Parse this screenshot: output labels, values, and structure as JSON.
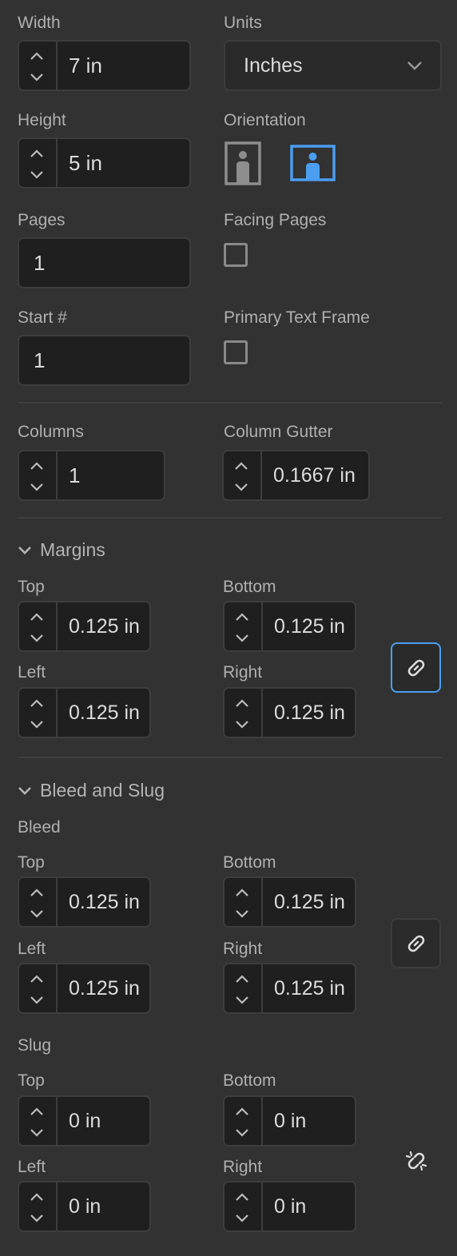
{
  "document": {
    "width_label": "Width",
    "width_value": "7 in",
    "units_label": "Units",
    "units_value": "Inches",
    "height_label": "Height",
    "height_value": "5 in",
    "orientation_label": "Orientation",
    "pages_label": "Pages",
    "pages_value": "1",
    "facing_label": "Facing Pages",
    "start_label": "Start #",
    "start_value": "1",
    "primary_label": "Primary Text Frame"
  },
  "columns": {
    "columns_label": "Columns",
    "columns_value": "1",
    "gutter_label": "Column Gutter",
    "gutter_value": "0.1667 in"
  },
  "margins": {
    "title": "Margins",
    "top_label": "Top",
    "top_value": "0.125 in",
    "bottom_label": "Bottom",
    "bottom_value": "0.125 in",
    "left_label": "Left",
    "left_value": "0.125 in",
    "right_label": "Right",
    "right_value": "0.125 in"
  },
  "bleed_slug": {
    "title": "Bleed and Slug",
    "bleed_label": "Bleed",
    "bleed_top_label": "Top",
    "bleed_top_value": "0.125 in",
    "bleed_bottom_label": "Bottom",
    "bleed_bottom_value": "0.125 in",
    "bleed_left_label": "Left",
    "bleed_left_value": "0.125 in",
    "bleed_right_label": "Right",
    "bleed_right_value": "0.125 in",
    "slug_label": "Slug",
    "slug_top_label": "Top",
    "slug_top_value": "0 in",
    "slug_bottom_label": "Bottom",
    "slug_bottom_value": "0 in",
    "slug_left_label": "Left",
    "slug_left_value": "0 in",
    "slug_right_label": "Right",
    "slug_right_value": "0 in"
  },
  "icons": {
    "spin": "up-down-arrows-icon",
    "dropdown": "chevron-down-icon",
    "portrait": "portrait-orientation-icon",
    "landscape": "landscape-orientation-icon",
    "link": "link-icon",
    "unlink": "unlink-icon"
  },
  "colors": {
    "accent": "#4b9ef0",
    "background": "#323232",
    "field": "#1f1f1f"
  }
}
